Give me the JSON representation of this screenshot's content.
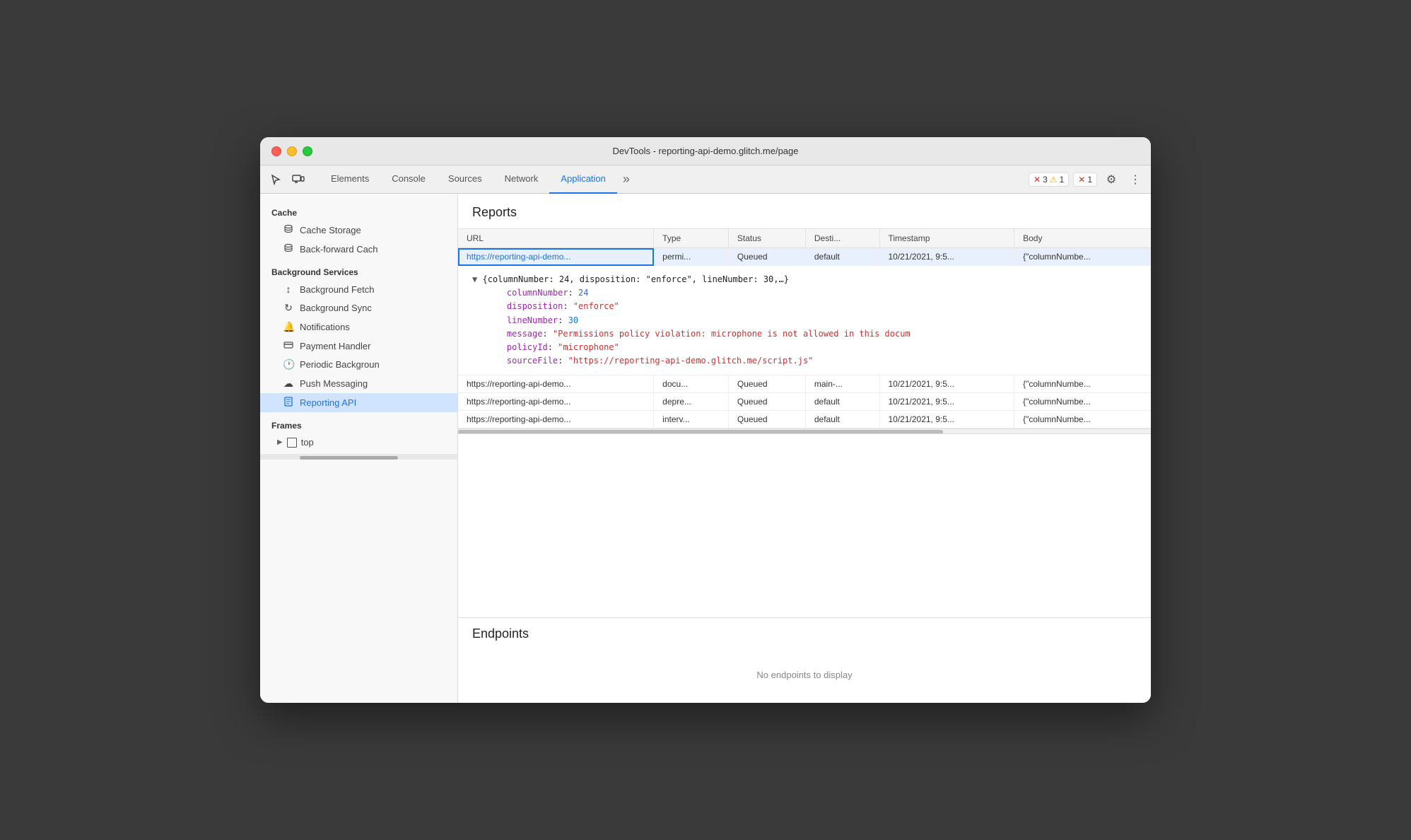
{
  "window": {
    "title": "DevTools - reporting-api-demo.glitch.me/page"
  },
  "toolbar": {
    "icons": [
      "cursor-icon",
      "layers-icon"
    ],
    "tabs": [
      {
        "label": "Elements",
        "active": false
      },
      {
        "label": "Console",
        "active": false
      },
      {
        "label": "Sources",
        "active": false
      },
      {
        "label": "Network",
        "active": false
      },
      {
        "label": "Application",
        "active": true
      }
    ],
    "more_label": "»",
    "error_badge": {
      "error_icon": "✕",
      "error_count": "3",
      "warn_icon": "⚠",
      "warn_count": "1"
    },
    "close_badge": {
      "icon": "✕",
      "count": "1"
    },
    "settings_icon": "⚙",
    "more_icon": "⋮"
  },
  "sidebar": {
    "cache_section": "Cache",
    "cache_items": [
      {
        "label": "Cache Storage",
        "icon": "🗄"
      },
      {
        "label": "Back-forward Cach",
        "icon": "🗄"
      }
    ],
    "bg_services_section": "Background Services",
    "bg_items": [
      {
        "label": "Background Fetch",
        "icon": "↕"
      },
      {
        "label": "Background Sync",
        "icon": "↻"
      },
      {
        "label": "Notifications",
        "icon": "🔔"
      },
      {
        "label": "Payment Handler",
        "icon": "🃏"
      },
      {
        "label": "Periodic Backgroun",
        "icon": "🕐"
      },
      {
        "label": "Push Messaging",
        "icon": "☁"
      },
      {
        "label": "Reporting API",
        "icon": "📄",
        "active": true
      }
    ],
    "frames_section": "Frames",
    "frames_items": [
      {
        "label": "top"
      }
    ]
  },
  "reports": {
    "title": "Reports",
    "columns": [
      "URL",
      "Type",
      "Status",
      "Desti...",
      "Timestamp",
      "Body"
    ],
    "rows": [
      {
        "url": "https://reporting-api-demo...",
        "type": "permi...",
        "status": "Queued",
        "dest": "default",
        "timestamp": "10/21/2021, 9:5...",
        "body": "{\"columnNumbe...",
        "selected": true
      },
      {
        "url": "https://reporting-api-demo...",
        "type": "docu...",
        "status": "Queued",
        "dest": "main-...",
        "timestamp": "10/21/2021, 9:5...",
        "body": "{\"columnNumbe...",
        "selected": false
      },
      {
        "url": "https://reporting-api-demo...",
        "type": "depre...",
        "status": "Queued",
        "dest": "default",
        "timestamp": "10/21/2021, 9:5...",
        "body": "{\"columnNumbe...",
        "selected": false
      },
      {
        "url": "https://reporting-api-demo...",
        "type": "interv...",
        "status": "Queued",
        "dest": "default",
        "timestamp": "10/21/2021, 9:5...",
        "body": "{\"columnNumbe...",
        "selected": false
      }
    ],
    "expanded": {
      "summary": "{columnNumber: 24, disposition: \"enforce\", lineNumber: 30,…}",
      "fields": [
        {
          "key": "columnNumber",
          "value": "24",
          "type": "number"
        },
        {
          "key": "disposition",
          "value": "\"enforce\"",
          "type": "string"
        },
        {
          "key": "lineNumber",
          "value": "30",
          "type": "number"
        },
        {
          "key": "message",
          "value": "\"Permissions policy violation: microphone is not allowed in this docum",
          "type": "string"
        },
        {
          "key": "policyId",
          "value": "\"microphone\"",
          "type": "string"
        },
        {
          "key": "sourceFile",
          "value": "\"https://reporting-api-demo.glitch.me/script.js\"",
          "type": "string"
        }
      ]
    }
  },
  "endpoints": {
    "title": "Endpoints",
    "empty_message": "No endpoints to display"
  }
}
